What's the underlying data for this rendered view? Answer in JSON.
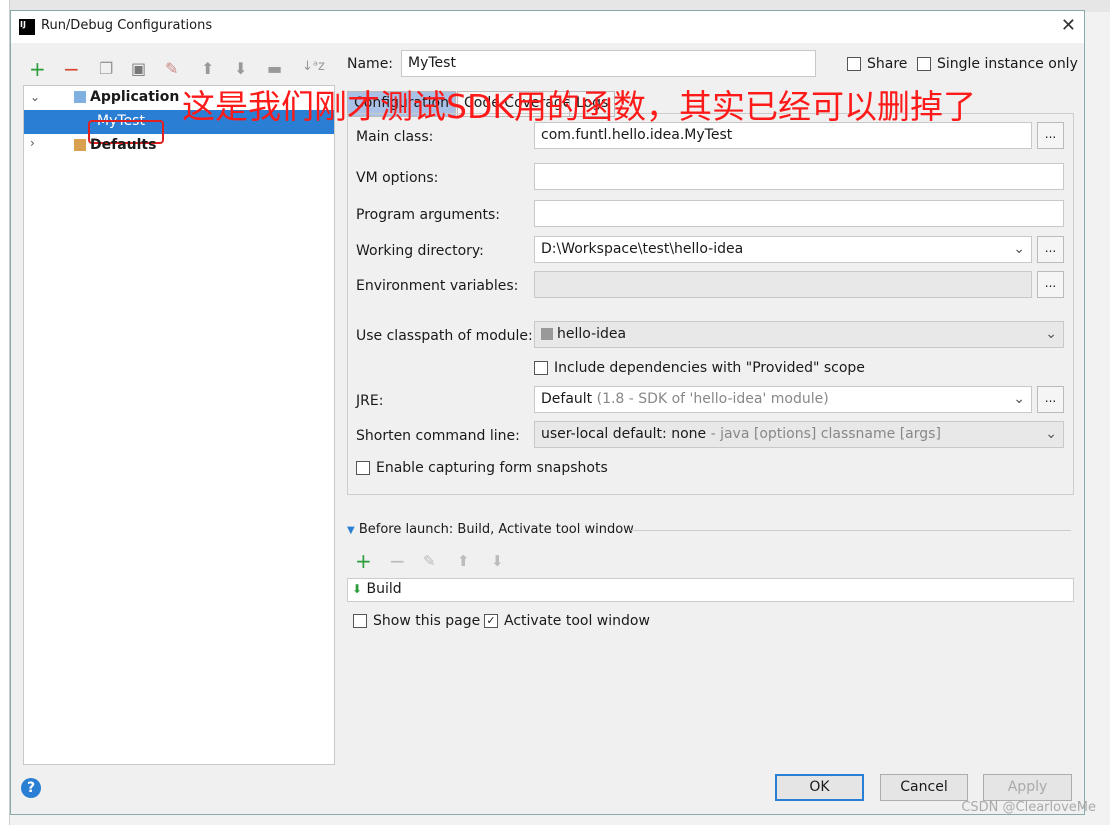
{
  "window": {
    "title": "Run/Debug Configurations",
    "logo": "IJ",
    "top_run_config": "MyTest"
  },
  "toolbar": {
    "icons": [
      "add-icon",
      "remove-icon",
      "copy-icon",
      "save-icon",
      "wrench-icon",
      "move-up-icon",
      "move-down-icon",
      "folder-icon",
      "sort-icon"
    ],
    "add": "+",
    "remove": "−"
  },
  "tree": {
    "application": "Application",
    "mytest": "MyTest",
    "defaults": "Defaults"
  },
  "annotation": "这是我们刚才测试SDK用的函数，其实已经可以删掉了",
  "name": {
    "label": "Name:",
    "value": "MyTest"
  },
  "share": "Share",
  "single_instance": "Single instance only",
  "tabs": [
    "Configuration",
    "Code Coverage",
    "Logs"
  ],
  "form": {
    "main_class": {
      "label": "Main class:",
      "value": "com.funtl.hello.idea.MyTest"
    },
    "vm_options": {
      "label": "VM options:",
      "value": ""
    },
    "program_arguments": {
      "label": "Program arguments:",
      "value": ""
    },
    "working_directory": {
      "label": "Working directory:",
      "value": "D:\\Workspace\\test\\hello-idea"
    },
    "environment_variables": {
      "label": "Environment variables:",
      "value": ""
    },
    "classpath_module": {
      "label": "Use classpath of module:",
      "value": "hello-idea"
    },
    "include_provided": {
      "label": "Include dependencies with \"Provided\" scope",
      "checked": false
    },
    "jre": {
      "label": "JRE:",
      "value": "Default",
      "hint": "(1.8 - SDK of 'hello-idea' module)"
    },
    "shorten": {
      "label": "Shorten command line:",
      "value": "user-local default: none",
      "hint": "- java [options] classname [args]"
    },
    "form_snapshots": {
      "label": "Enable capturing form snapshots",
      "checked": false
    }
  },
  "before_launch": {
    "title": "Before launch: Build, Activate tool window",
    "items": [
      "Build"
    ]
  },
  "show_page": {
    "label": "Show this page",
    "checked": false
  },
  "activate_tool": {
    "label": "Activate tool window",
    "checked": true
  },
  "buttons": {
    "ok": "OK",
    "cancel": "Cancel",
    "apply": "Apply",
    "ellipsis": "..."
  },
  "watermark": "CSDN @ClearloveMe"
}
